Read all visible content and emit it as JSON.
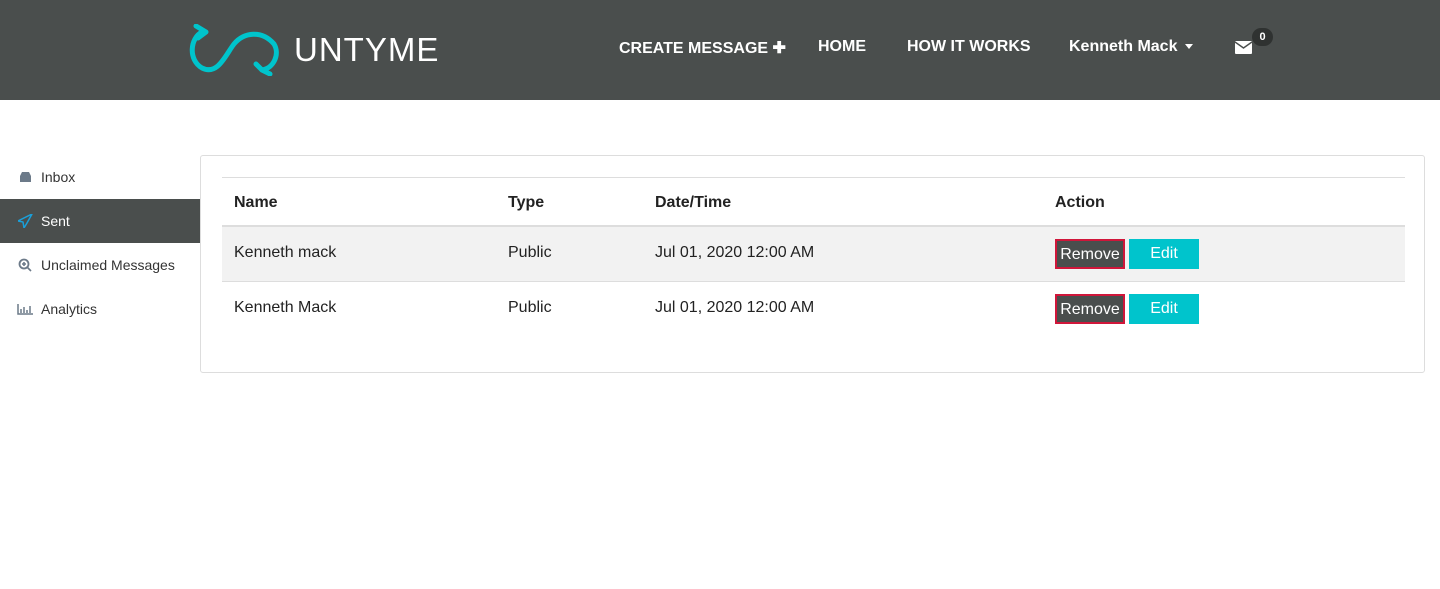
{
  "header": {
    "logo_text": "UNTYME",
    "nav": {
      "create": "CREATE MESSAGE",
      "home": "HOME",
      "how": "HOW IT WORKS",
      "user": "Kenneth Mack"
    },
    "message_count": "0"
  },
  "sidebar": {
    "items": [
      {
        "label": "Inbox",
        "icon": "inbox-icon"
      },
      {
        "label": "Sent",
        "icon": "paper-plane-icon"
      },
      {
        "label": "Unclaimed Messages",
        "icon": "search-plus-icon"
      },
      {
        "label": "Analytics",
        "icon": "bar-chart-icon"
      }
    ]
  },
  "table": {
    "headers": [
      "Name",
      "Type",
      "Date/Time",
      "Action"
    ],
    "rows": [
      {
        "name": "Kenneth mack",
        "type": "Public",
        "datetime": "Jul 01, 2020 12:00 AM"
      },
      {
        "name": "Kenneth Mack",
        "type": "Public",
        "datetime": "Jul 01, 2020 12:00 AM"
      }
    ],
    "remove_label": "Remove",
    "edit_label": "Edit"
  },
  "colors": {
    "header": "#4a4e4d",
    "accent": "#00c4cc",
    "danger": "#d0163a"
  }
}
